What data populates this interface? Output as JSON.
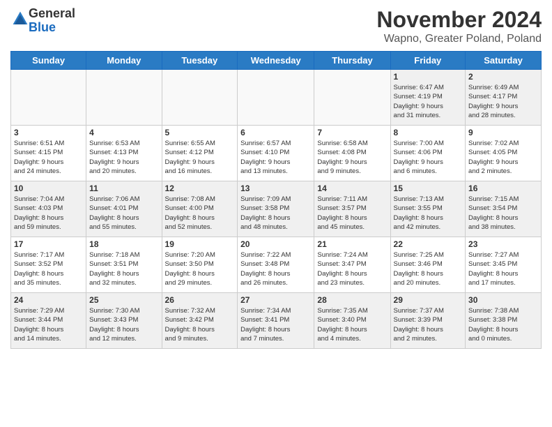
{
  "logo": {
    "general": "General",
    "blue": "Blue"
  },
  "title": "November 2024",
  "subtitle": "Wapno, Greater Poland, Poland",
  "headers": [
    "Sunday",
    "Monday",
    "Tuesday",
    "Wednesday",
    "Thursday",
    "Friday",
    "Saturday"
  ],
  "weeks": [
    [
      {
        "day": "",
        "info": ""
      },
      {
        "day": "",
        "info": ""
      },
      {
        "day": "",
        "info": ""
      },
      {
        "day": "",
        "info": ""
      },
      {
        "day": "",
        "info": ""
      },
      {
        "day": "1",
        "info": "Sunrise: 6:47 AM\nSunset: 4:19 PM\nDaylight: 9 hours\nand 31 minutes."
      },
      {
        "day": "2",
        "info": "Sunrise: 6:49 AM\nSunset: 4:17 PM\nDaylight: 9 hours\nand 28 minutes."
      }
    ],
    [
      {
        "day": "3",
        "info": "Sunrise: 6:51 AM\nSunset: 4:15 PM\nDaylight: 9 hours\nand 24 minutes."
      },
      {
        "day": "4",
        "info": "Sunrise: 6:53 AM\nSunset: 4:13 PM\nDaylight: 9 hours\nand 20 minutes."
      },
      {
        "day": "5",
        "info": "Sunrise: 6:55 AM\nSunset: 4:12 PM\nDaylight: 9 hours\nand 16 minutes."
      },
      {
        "day": "6",
        "info": "Sunrise: 6:57 AM\nSunset: 4:10 PM\nDaylight: 9 hours\nand 13 minutes."
      },
      {
        "day": "7",
        "info": "Sunrise: 6:58 AM\nSunset: 4:08 PM\nDaylight: 9 hours\nand 9 minutes."
      },
      {
        "day": "8",
        "info": "Sunrise: 7:00 AM\nSunset: 4:06 PM\nDaylight: 9 hours\nand 6 minutes."
      },
      {
        "day": "9",
        "info": "Sunrise: 7:02 AM\nSunset: 4:05 PM\nDaylight: 9 hours\nand 2 minutes."
      }
    ],
    [
      {
        "day": "10",
        "info": "Sunrise: 7:04 AM\nSunset: 4:03 PM\nDaylight: 8 hours\nand 59 minutes."
      },
      {
        "day": "11",
        "info": "Sunrise: 7:06 AM\nSunset: 4:01 PM\nDaylight: 8 hours\nand 55 minutes."
      },
      {
        "day": "12",
        "info": "Sunrise: 7:08 AM\nSunset: 4:00 PM\nDaylight: 8 hours\nand 52 minutes."
      },
      {
        "day": "13",
        "info": "Sunrise: 7:09 AM\nSunset: 3:58 PM\nDaylight: 8 hours\nand 48 minutes."
      },
      {
        "day": "14",
        "info": "Sunrise: 7:11 AM\nSunset: 3:57 PM\nDaylight: 8 hours\nand 45 minutes."
      },
      {
        "day": "15",
        "info": "Sunrise: 7:13 AM\nSunset: 3:55 PM\nDaylight: 8 hours\nand 42 minutes."
      },
      {
        "day": "16",
        "info": "Sunrise: 7:15 AM\nSunset: 3:54 PM\nDaylight: 8 hours\nand 38 minutes."
      }
    ],
    [
      {
        "day": "17",
        "info": "Sunrise: 7:17 AM\nSunset: 3:52 PM\nDaylight: 8 hours\nand 35 minutes."
      },
      {
        "day": "18",
        "info": "Sunrise: 7:18 AM\nSunset: 3:51 PM\nDaylight: 8 hours\nand 32 minutes."
      },
      {
        "day": "19",
        "info": "Sunrise: 7:20 AM\nSunset: 3:50 PM\nDaylight: 8 hours\nand 29 minutes."
      },
      {
        "day": "20",
        "info": "Sunrise: 7:22 AM\nSunset: 3:48 PM\nDaylight: 8 hours\nand 26 minutes."
      },
      {
        "day": "21",
        "info": "Sunrise: 7:24 AM\nSunset: 3:47 PM\nDaylight: 8 hours\nand 23 minutes."
      },
      {
        "day": "22",
        "info": "Sunrise: 7:25 AM\nSunset: 3:46 PM\nDaylight: 8 hours\nand 20 minutes."
      },
      {
        "day": "23",
        "info": "Sunrise: 7:27 AM\nSunset: 3:45 PM\nDaylight: 8 hours\nand 17 minutes."
      }
    ],
    [
      {
        "day": "24",
        "info": "Sunrise: 7:29 AM\nSunset: 3:44 PM\nDaylight: 8 hours\nand 14 minutes."
      },
      {
        "day": "25",
        "info": "Sunrise: 7:30 AM\nSunset: 3:43 PM\nDaylight: 8 hours\nand 12 minutes."
      },
      {
        "day": "26",
        "info": "Sunrise: 7:32 AM\nSunset: 3:42 PM\nDaylight: 8 hours\nand 9 minutes."
      },
      {
        "day": "27",
        "info": "Sunrise: 7:34 AM\nSunset: 3:41 PM\nDaylight: 8 hours\nand 7 minutes."
      },
      {
        "day": "28",
        "info": "Sunrise: 7:35 AM\nSunset: 3:40 PM\nDaylight: 8 hours\nand 4 minutes."
      },
      {
        "day": "29",
        "info": "Sunrise: 7:37 AM\nSunset: 3:39 PM\nDaylight: 8 hours\nand 2 minutes."
      },
      {
        "day": "30",
        "info": "Sunrise: 7:38 AM\nSunset: 3:38 PM\nDaylight: 8 hours\nand 0 minutes."
      }
    ]
  ]
}
